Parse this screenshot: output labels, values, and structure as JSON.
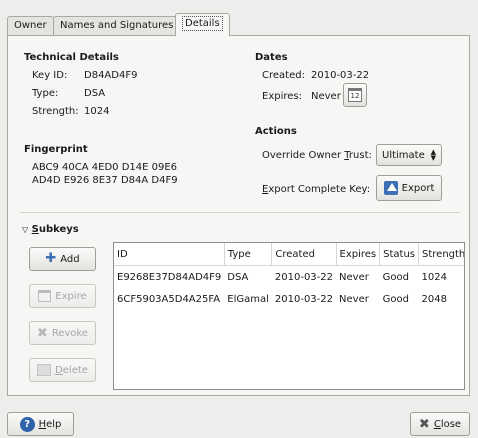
{
  "tabs": [
    {
      "label": "Owner"
    },
    {
      "label": "Names and Signatures"
    },
    {
      "label": "Details"
    }
  ],
  "technical": {
    "heading": "Technical Details",
    "key_id_label": "Key ID:",
    "key_id": "D84AD4F9",
    "type_label": "Type:",
    "type": "DSA",
    "strength_label": "Strength:",
    "strength": "1024"
  },
  "fingerprint": {
    "heading": "Fingerprint",
    "line1": "ABC9 40CA 4ED0 D14E 09E6",
    "line2": "AD4D E926 8E37 D84A D4F9"
  },
  "dates": {
    "heading": "Dates",
    "created_label": "Created:",
    "created": "2010-03-22",
    "expires_label": "Expires:",
    "expires": "Never",
    "calendar_icon_day": "12"
  },
  "actions": {
    "heading": "Actions",
    "trust_label_pre": "Override Owner ",
    "trust_label_u": "T",
    "trust_label_post": "rust:",
    "trust_value": "Ultimate",
    "export_label_pre": "",
    "export_label_u": "E",
    "export_label_post": "xport Complete Key:",
    "export_button": "Export"
  },
  "subkeys": {
    "heading_u": "S",
    "heading_rest": "ubkeys",
    "add": "Add",
    "expire": "Expire",
    "revoke": "Revoke",
    "delete_u": "D",
    "delete_rest": "elete",
    "columns": [
      "ID",
      "Type",
      "Created",
      "Expires",
      "Status",
      "Strength"
    ],
    "rows": [
      [
        "E9268E37D84AD4F9",
        "DSA",
        "2010-03-22",
        "Never",
        "Good",
        "1024"
      ],
      [
        "6CF5903A5D4A25FA",
        "ElGamal",
        "2010-03-22",
        "Never",
        "Good",
        "2048"
      ]
    ]
  },
  "footer": {
    "help_u": "H",
    "help_rest": "elp",
    "close_u": "C",
    "close_rest": "lose"
  }
}
